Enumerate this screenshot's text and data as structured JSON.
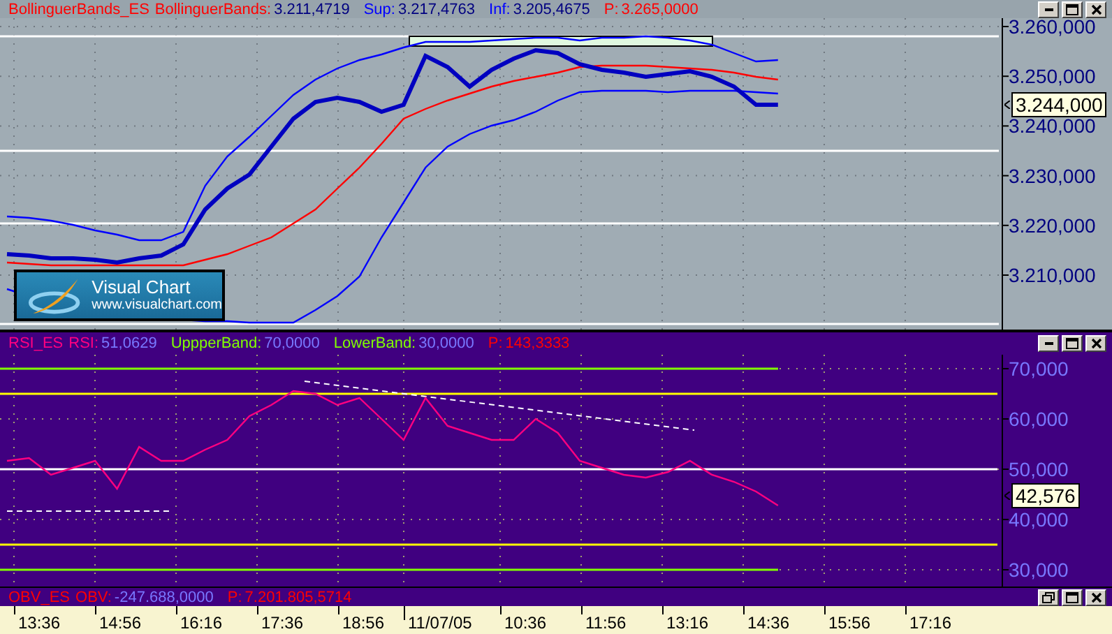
{
  "price_pane": {
    "legend": [
      {
        "kind": "name",
        "label": "BollinguerBands_ES",
        "color": "#ff0000"
      },
      {
        "kind": "value",
        "label": "BollinguerBands:",
        "value": "3.211,4719",
        "color": "#ff0000"
      },
      {
        "kind": "value",
        "label": "Sup:",
        "value": "3.217,4763",
        "color": "#0000ff"
      },
      {
        "kind": "value",
        "label": "Inf:",
        "value": "3.205,4675",
        "color": "#0000ff"
      },
      {
        "kind": "price",
        "label": "P:",
        "value": "3.265,0000",
        "color": "#ff0000"
      }
    ],
    "buttons": [
      {
        "kind": "minimize"
      },
      {
        "kind": "maximize"
      },
      {
        "kind": "close"
      }
    ],
    "logo": {
      "name": "Visual Chart",
      "url": "www.visualchart.com"
    },
    "axis_labels": [
      "3.260,000",
      "3.250,000",
      "3.240,000",
      "3.230,000",
      "3.220,000",
      "3.210,000"
    ],
    "current_value": "3.244,000"
  },
  "rsi_pane": {
    "legend": [
      {
        "kind": "name",
        "label": "RSI_ES",
        "color": "#ff0080"
      },
      {
        "kind": "value",
        "label": "RSI:",
        "value": "51,0629",
        "color": "#ff0080"
      },
      {
        "kind": "value",
        "label": "UppperBand:",
        "value": "70,0000",
        "color": "#80ff00"
      },
      {
        "kind": "value",
        "label": "LowerBand:",
        "value": "30,0000",
        "color": "#80ff00"
      },
      {
        "kind": "price",
        "label": "P:",
        "value": "143,3333",
        "color": "#ff0000"
      }
    ],
    "buttons": [
      {
        "kind": "minimize"
      },
      {
        "kind": "maximize"
      },
      {
        "kind": "close"
      }
    ],
    "axis_labels": [
      "70,000",
      "60,000",
      "50,000",
      "40,000",
      "30,000"
    ],
    "current_value": "42,576"
  },
  "obv_pane": {
    "legend": [
      {
        "kind": "name",
        "label": "OBV_ES",
        "color": "#ff0000"
      },
      {
        "kind": "value",
        "label": "OBV:",
        "value": "-247.688,0000",
        "color": "#ff0000"
      },
      {
        "kind": "price",
        "label": "P:",
        "value": "7.201.805,5714",
        "color": "#ff0000"
      }
    ],
    "buttons": [
      {
        "kind": "restore"
      },
      {
        "kind": "maximize"
      },
      {
        "kind": "close"
      }
    ]
  },
  "time_axis": [
    {
      "kind": "time",
      "label": "13:36"
    },
    {
      "kind": "time",
      "label": "14:56"
    },
    {
      "kind": "time",
      "label": "16:16"
    },
    {
      "kind": "time",
      "label": "17:36"
    },
    {
      "kind": "time",
      "label": "18:56"
    },
    {
      "kind": "date",
      "label": "11/07/05"
    },
    {
      "kind": "time",
      "label": "10:36"
    },
    {
      "kind": "time",
      "label": "11:56"
    },
    {
      "kind": "time",
      "label": "13:16"
    },
    {
      "kind": "time",
      "label": "14:36"
    },
    {
      "kind": "time",
      "label": "15:56"
    },
    {
      "kind": "time",
      "label": "17:16"
    }
  ]
}
